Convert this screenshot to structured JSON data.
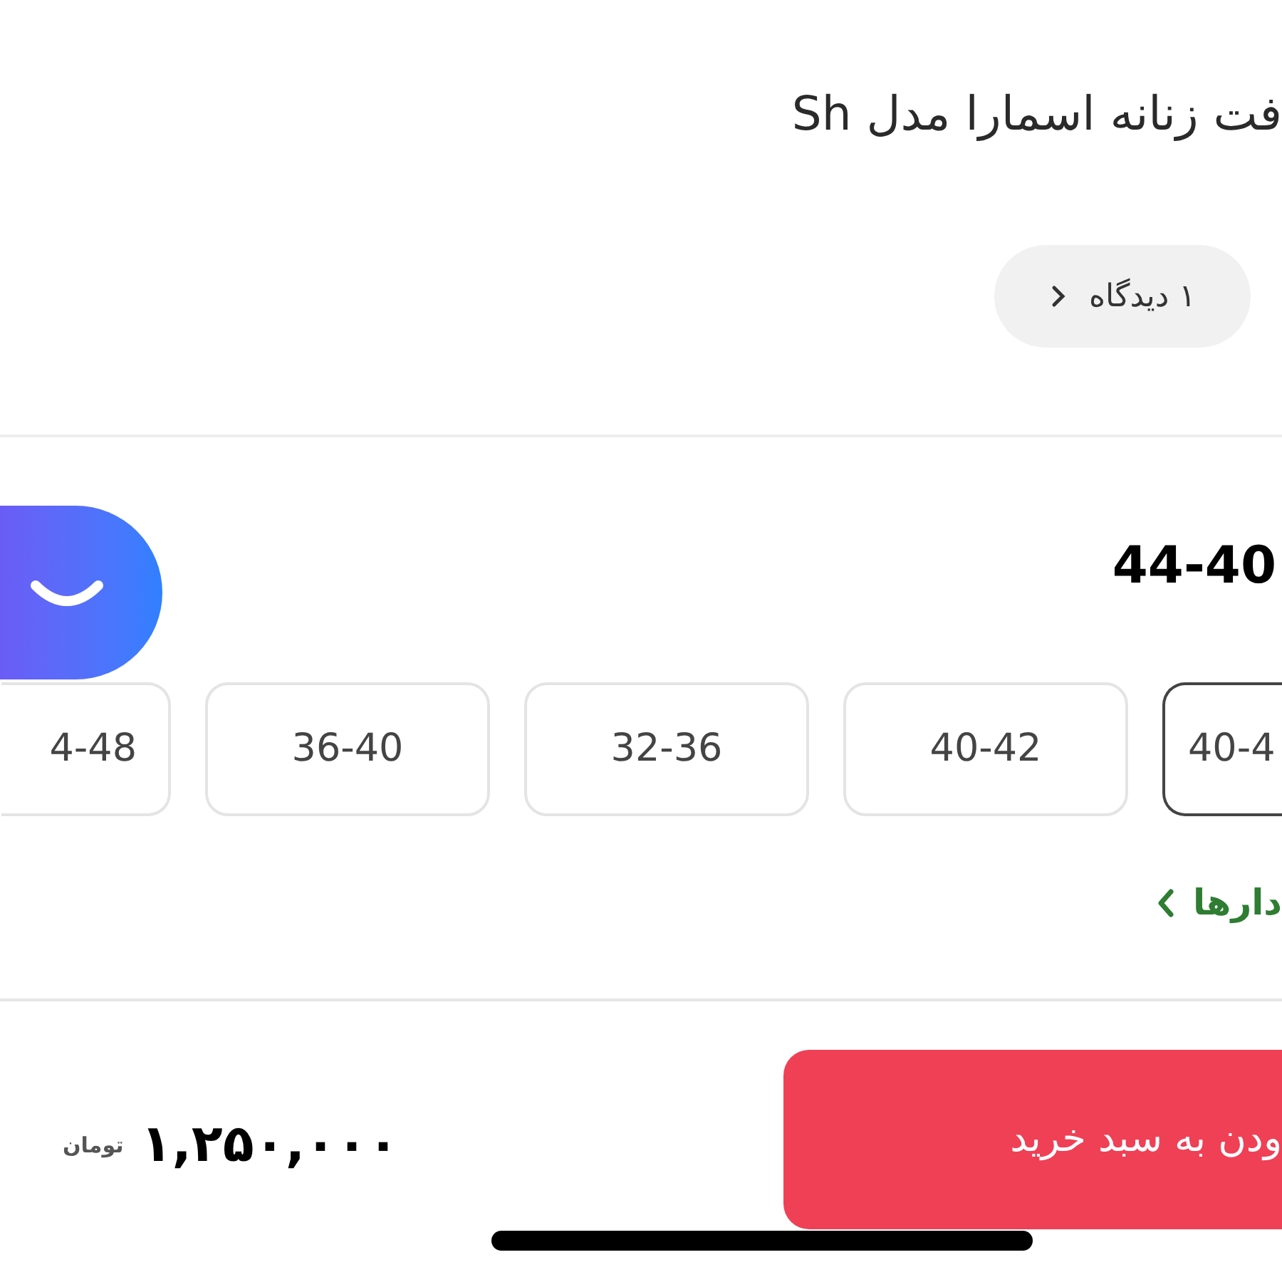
{
  "product_title": "فت زنانه اسمارا مدل Sh",
  "reviews_button": {
    "label": "۱ دیدگاه"
  },
  "size_section": {
    "selected_size_label": "44-40",
    "options": [
      {
        "label": "40-4",
        "selected": true
      },
      {
        "label": "40-42",
        "selected": false
      },
      {
        "label": "32-36",
        "selected": false
      },
      {
        "label": "36-40",
        "selected": false
      },
      {
        "label": "4-48",
        "selected": false
      }
    ]
  },
  "size_guide_link": {
    "label": "دارها"
  },
  "price": {
    "amount": "۱,۲۵۰,۰۰۰",
    "currency": "تومان"
  },
  "add_to_cart_button": {
    "label": "ودن به سبد خرید"
  }
}
